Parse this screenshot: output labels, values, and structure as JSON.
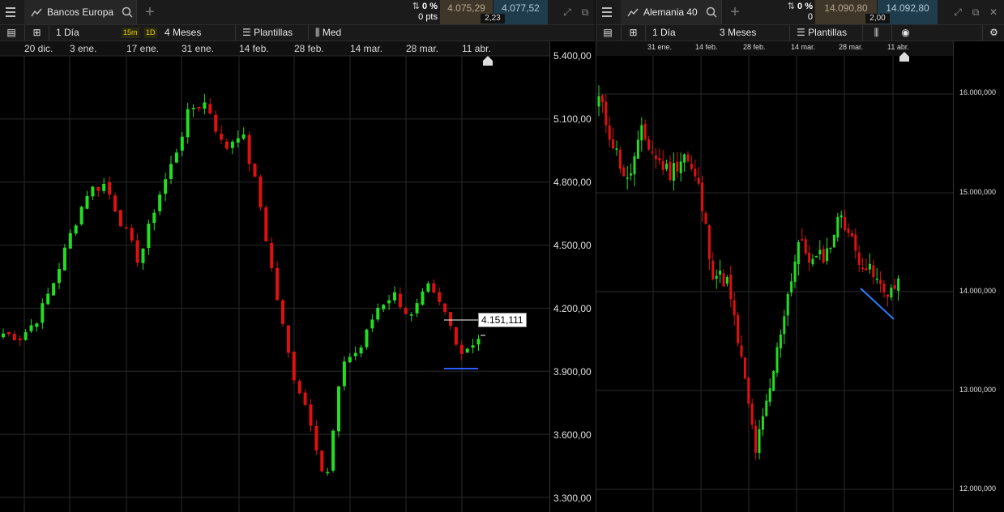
{
  "left": {
    "instrument": "Bancos Europa",
    "change_pct": "0 %",
    "change_pts": "0 pts",
    "sell": "4.075,29",
    "buy": "4.077,52",
    "spread": "2,23",
    "interval": "1 Día",
    "badge_15m": "15m",
    "badge_1d": "1D",
    "range": "4 Meses",
    "templates": "Plantillas",
    "indicator": "Med",
    "dates": [
      "20 dic.",
      "3 ene.",
      "17 ene.",
      "31 ene.",
      "14 feb.",
      "28 feb.",
      "14 mar.",
      "28 mar.",
      "11 abr."
    ],
    "y_labels": [
      "5.400,00",
      "5.100,00",
      "4.800,00",
      "4.500,00",
      "4.200,00",
      "3.900,00",
      "3.600,00",
      "3.300,00"
    ],
    "price_tag": "4.151,111",
    "colors": {
      "up": "#22dd22",
      "down": "#e01010",
      "line": "#2a5bff"
    }
  },
  "right": {
    "instrument": "Alemania 40",
    "change_pct": "0 %",
    "change_pts": "0",
    "sell": "14.090,80",
    "buy": "14.092,80",
    "spread": "2,00",
    "interval": "1 Día",
    "range": "3 Meses",
    "templates": "Plantillas",
    "dates": [
      "31 ene.",
      "14 feb.",
      "28 feb.",
      "14 mar.",
      "28 mar.",
      "11 abr."
    ],
    "y_labels": [
      "16.000,000",
      "15.000,000",
      "14.000,000",
      "13.000,000",
      "12.000,000"
    ],
    "colors": {
      "up": "#22dd22",
      "down": "#e01010",
      "line": "#2a7bff"
    }
  },
  "chart_data": [
    {
      "type": "candlestick",
      "title": "Bancos Europa",
      "x": [
        "20 dic.",
        "3 ene.",
        "17 ene.",
        "31 ene.",
        "14 feb.",
        "28 feb.",
        "14 mar.",
        "28 mar.",
        "11 abr."
      ],
      "ylim": [
        3300,
        5400
      ],
      "grid": true,
      "last_marker": 4151.111
    },
    {
      "type": "candlestick",
      "title": "Alemania 40",
      "x": [
        "31 ene.",
        "14 feb.",
        "28 feb.",
        "14 mar.",
        "28 mar.",
        "11 abr."
      ],
      "ylim": [
        12000,
        16000
      ],
      "grid": true
    }
  ]
}
